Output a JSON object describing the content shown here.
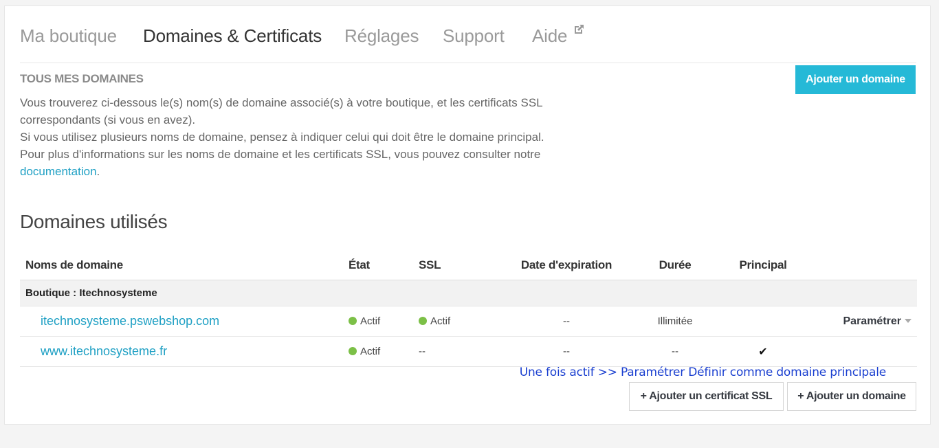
{
  "tabs": [
    {
      "label": "Ma boutique"
    },
    {
      "label": "Domaines & Certificats"
    },
    {
      "label": "Réglages"
    },
    {
      "label": "Support"
    },
    {
      "label": "Aide"
    }
  ],
  "header": {
    "section_title": "TOUS MES DOMAINES",
    "add_domain_button": "Ajouter un domaine"
  },
  "intro": {
    "line1": "Vous trouverez ci-dessous le(s) nom(s) de domaine associé(s) à votre boutique, et les certificats SSL correspondants (si vous en avez).",
    "line2": "Si vous utilisez plusieurs noms de domaine, pensez à indiquer celui qui doit être le domaine principal.",
    "line3": "Pour plus d'informations sur les noms de domaine et les certificats SSL, vous pouvez consulter notre ",
    "link": "documentation",
    "after_link": "."
  },
  "domains_section": {
    "title": "Domaines utilisés",
    "columns": [
      "Noms de domaine",
      "État",
      "SSL",
      "Date d'expiration",
      "Durée",
      "Principal",
      ""
    ],
    "group_label": "Boutique : Itechnosysteme",
    "rows": [
      {
        "domain": "itechnosysteme.pswebshop.com",
        "state": "Actif",
        "ssl": "Actif",
        "expiration": "--",
        "duration": "Illimitée",
        "principal": "",
        "action": "Paramétrer"
      },
      {
        "domain": "www.itechnosysteme.fr",
        "state": "Actif",
        "ssl": "--",
        "expiration": "--",
        "duration": "--",
        "principal": "✔",
        "action": ""
      }
    ]
  },
  "annotation": "Une fois actif >> Paramétrer Définir comme domaine principale",
  "footer_buttons": {
    "add_ssl": "+ Ajouter un certificat SSL",
    "add_domain": "+ Ajouter un domaine"
  },
  "colors": {
    "accent": "#25b9d7",
    "link": "#1fa0c4",
    "status_ok": "#7cc047",
    "annotation": "#1a3fd0"
  }
}
